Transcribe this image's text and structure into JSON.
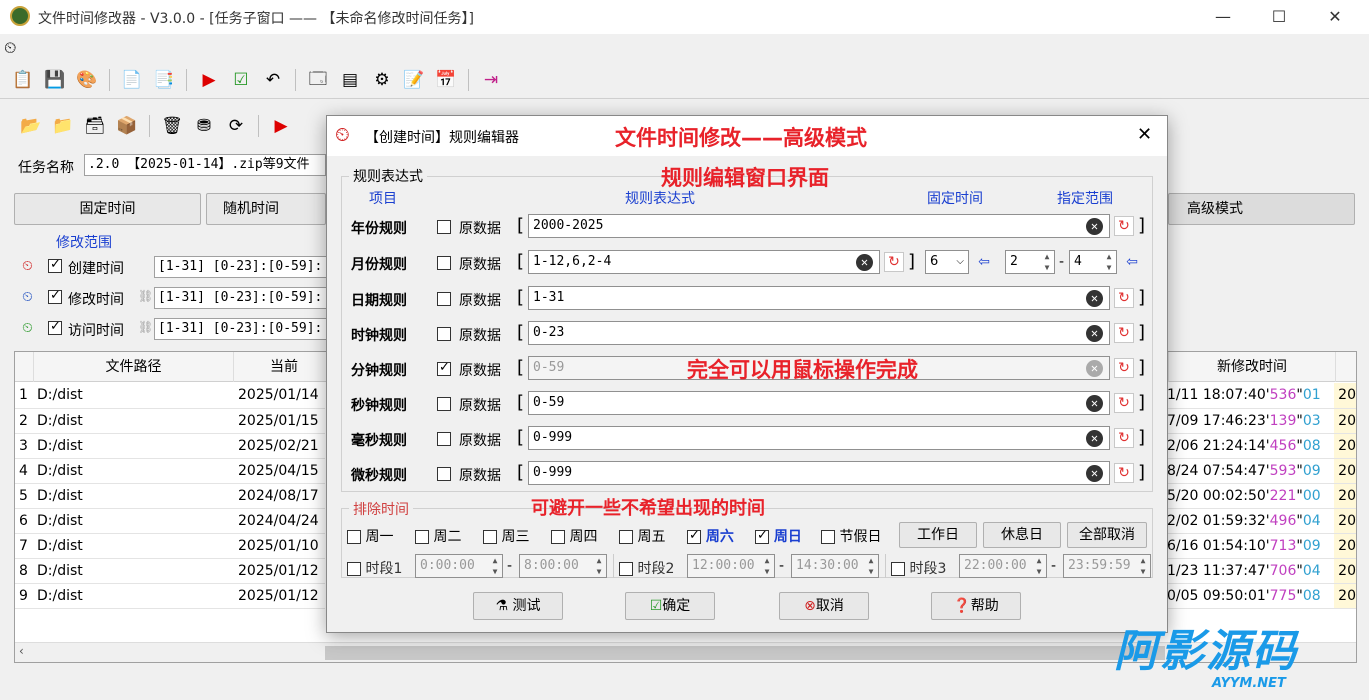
{
  "window": {
    "title": "文件时间修改器 - V3.0.0 - [任务子窗口 —— 【未命名修改时间任务】]",
    "min": "—",
    "max": "☐",
    "close": "✕"
  },
  "task": {
    "label": "任务名称",
    "value": ".2.0 【2025-01-14】.zip等9文件"
  },
  "mode_tabs": {
    "fixed": "固定时间",
    "random": "随机时间",
    "advanced": "高级模式"
  },
  "scope": {
    "heading": "修改范围",
    "items": [
      {
        "label": "创建时间",
        "value": "[1-31] [0-23]:[0-59]:"
      },
      {
        "label": "修改时间",
        "value": "[1-31] [0-23]:[0-59]:"
      },
      {
        "label": "访问时间",
        "value": "[1-31] [0-23]:[0-59]:"
      }
    ]
  },
  "table": {
    "col_path": "文件路径",
    "col_current": "当前",
    "col_new": "新修改时间",
    "rows": [
      {
        "n": "1",
        "path": "D:/dist",
        "date": "2025/01/14",
        "nt": "1/11 18:07:40'",
        "ms": "536",
        "us": "01",
        "tail": "20"
      },
      {
        "n": "2",
        "path": "D:/dist",
        "date": "2025/01/15",
        "nt": "7/09 17:46:23'",
        "ms": "139",
        "us": "03",
        "tail": "20"
      },
      {
        "n": "3",
        "path": "D:/dist",
        "date": "2025/02/21",
        "nt": "2/06 21:24:14'",
        "ms": "456",
        "us": "08",
        "tail": "20"
      },
      {
        "n": "4",
        "path": "D:/dist",
        "date": "2025/04/15",
        "nt": "8/24 07:54:47'",
        "ms": "593",
        "us": "09",
        "tail": "20"
      },
      {
        "n": "5",
        "path": "D:/dist",
        "date": "2024/08/17",
        "nt": "5/20 00:02:50'",
        "ms": "221",
        "us": "00",
        "tail": "20"
      },
      {
        "n": "6",
        "path": "D:/dist",
        "date": "2024/04/24",
        "nt": "2/02 01:59:32'",
        "ms": "496",
        "us": "04",
        "tail": "20"
      },
      {
        "n": "7",
        "path": "D:/dist",
        "date": "2025/01/10",
        "nt": "6/16 01:54:10'",
        "ms": "713",
        "us": "09",
        "tail": "20"
      },
      {
        "n": "8",
        "path": "D:/dist",
        "date": "2025/01/12",
        "nt": "1/23 11:37:47'",
        "ms": "706",
        "us": "04",
        "tail": "20"
      },
      {
        "n": "9",
        "path": "D:/dist",
        "date": "2025/01/12",
        "nt": "0/05 09:50:01'",
        "ms": "775",
        "us": "08",
        "tail": "20"
      }
    ]
  },
  "dialog": {
    "title": "【创建时间】规则编辑器",
    "close": "✕",
    "annotations": {
      "a1": "文件时间修改——高级模式",
      "a2": "规则编辑窗口界面",
      "a3": "完全可以用鼠标操作完成",
      "a4": "可避开一些不希望出现的时间"
    },
    "group_label": "规则表达式",
    "headers": {
      "item": "项目",
      "expr": "规则表达式",
      "fixed": "固定时间",
      "range": "指定范围"
    },
    "raw_label": "原数据",
    "rules": [
      {
        "label": "年份规则",
        "value": "2000-2025",
        "raw": false,
        "disabled": false
      },
      {
        "label": "月份规则",
        "value": "1-12,6,2-4",
        "raw": false,
        "disabled": false
      },
      {
        "label": "日期规则",
        "value": "1-31",
        "raw": false,
        "disabled": false
      },
      {
        "label": "时钟规则",
        "value": "0-23",
        "raw": false,
        "disabled": false
      },
      {
        "label": "分钟规则",
        "value": "0-59",
        "raw": true,
        "disabled": true
      },
      {
        "label": "秒钟规则",
        "value": "0-59",
        "raw": false,
        "disabled": false
      },
      {
        "label": "毫秒规则",
        "value": "0-999",
        "raw": false,
        "disabled": false
      },
      {
        "label": "微秒规则",
        "value": "0-999",
        "raw": false,
        "disabled": false
      }
    ],
    "month_fixed": "6",
    "month_from": "2",
    "month_to": "4",
    "exclude_label": "排除时间",
    "weekdays": [
      {
        "label": "周一",
        "on": false
      },
      {
        "label": "周二",
        "on": false
      },
      {
        "label": "周三",
        "on": false
      },
      {
        "label": "周四",
        "on": false
      },
      {
        "label": "周五",
        "on": false
      },
      {
        "label": "周六",
        "on": true
      },
      {
        "label": "周日",
        "on": true
      },
      {
        "label": "节假日",
        "on": false
      }
    ],
    "day_buttons": {
      "work": "工作日",
      "rest": "休息日",
      "clear": "全部取消"
    },
    "periods": [
      {
        "label": "时段1",
        "from": "0:00:00",
        "to": "8:00:00"
      },
      {
        "label": "时段2",
        "from": "12:00:00",
        "to": "14:30:00"
      },
      {
        "label": "时段3",
        "from": "22:00:00",
        "to": "23:59:59"
      }
    ],
    "buttons": {
      "test": "测试",
      "ok": "确定",
      "cancel": "取消",
      "help": "帮助"
    }
  },
  "watermark": {
    "cn": "阿影源码",
    "en": "AYYM.NET"
  },
  "colors": {
    "ann_red": "#e8222a",
    "header_blue": "#1a3fd0",
    "ms_color": "#c040c0",
    "us_color": "#30a0d0"
  }
}
